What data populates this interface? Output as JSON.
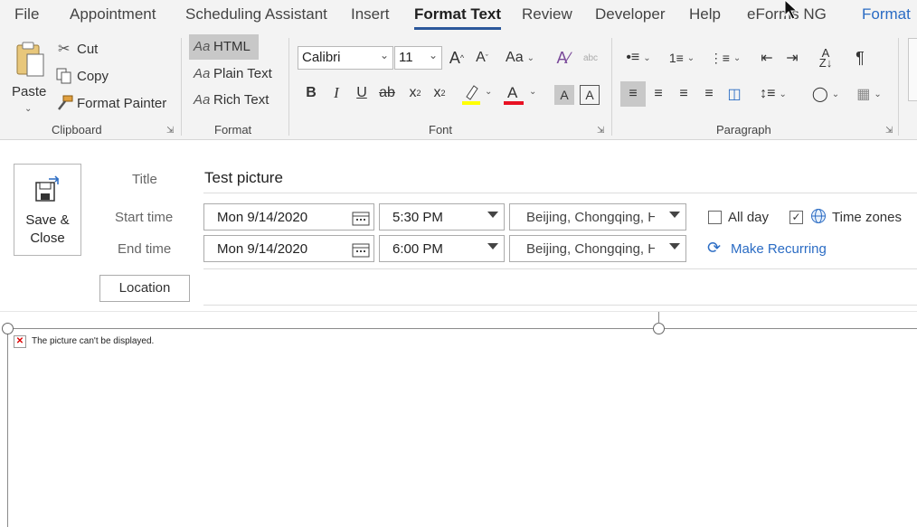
{
  "menu": {
    "tabs": [
      "File",
      "Appointment",
      "Scheduling Assistant",
      "Insert",
      "Format Text",
      "Review",
      "Developer",
      "Help",
      "eForms NG",
      "Format"
    ]
  },
  "ribbon": {
    "clipboard": {
      "label": "Clipboard",
      "paste": "Paste",
      "cut": "Cut",
      "copy": "Copy",
      "format_painter": "Format Painter"
    },
    "format": {
      "label": "Format",
      "html": "HTML",
      "plain": "Plain Text",
      "rich": "Rich Text",
      "prefix": "Aa"
    },
    "font": {
      "label": "Font",
      "family": "Calibri",
      "size": "11",
      "highlight_color": "#ffff00",
      "font_color": "#e81123"
    },
    "paragraph": {
      "label": "Paragraph"
    }
  },
  "form": {
    "save_close": "Save &\nClose",
    "title_label": "Title",
    "title_value": "Test picture",
    "start_label": "Start time",
    "end_label": "End time",
    "start_date": "Mon 9/14/2020",
    "start_time": "5:30 PM",
    "end_date": "Mon 9/14/2020",
    "end_time": "6:00 PM",
    "start_tz": "Beijing, Chongqing, Ho",
    "end_tz": "Beijing, Chongqing, Ho",
    "all_day": "All day",
    "all_day_checked": false,
    "time_zones": "Time zones",
    "time_zones_checked": true,
    "make_recurring": "Make Recurring",
    "location_button": "Location"
  },
  "body": {
    "broken_image_text": "The picture can't be displayed."
  }
}
